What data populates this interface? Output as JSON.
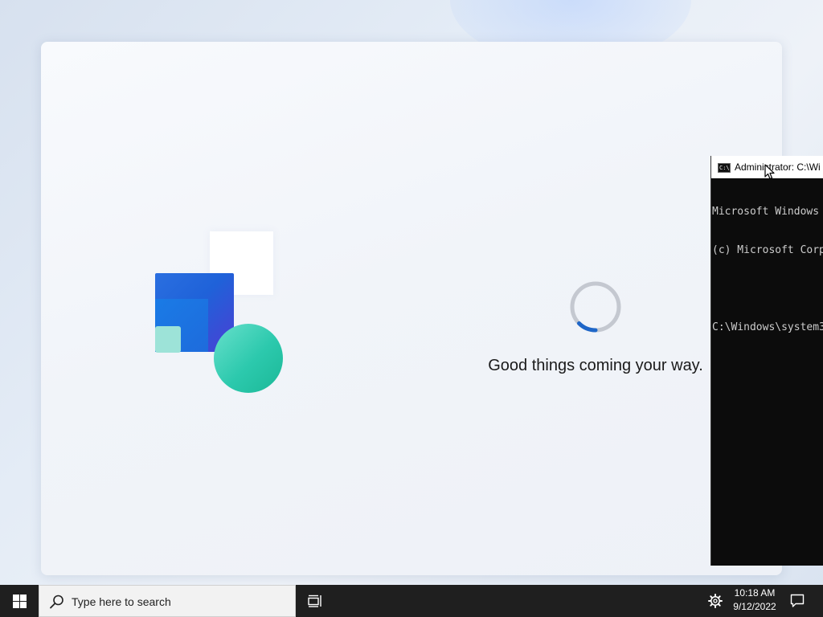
{
  "oobe": {
    "status_text": "Good things coming your way.",
    "spinner_icon": "loading-spinner-icon",
    "colors": {
      "spinner_track": "#c4c8d0",
      "spinner_arc": "#1e66c8",
      "hero_blue": "#1f62d9",
      "hero_teal": "#2cc9ad"
    }
  },
  "console": {
    "title": "Administrator: C:\\Wi",
    "lines": [
      "Microsoft Windows",
      "(c) Microsoft Corp",
      "",
      "C:\\Windows\\system3"
    ],
    "background": "#0c0c0c",
    "text_color": "#cccccc"
  },
  "taskbar": {
    "start_icon": "windows-logo-icon",
    "search_placeholder": "Type here to search",
    "task_view_icon": "task-view-icon",
    "settings_icon": "gear-icon",
    "clock": {
      "time": "10:18 AM",
      "date": "9/12/2022"
    },
    "notifications_icon": "notification-center-icon"
  }
}
